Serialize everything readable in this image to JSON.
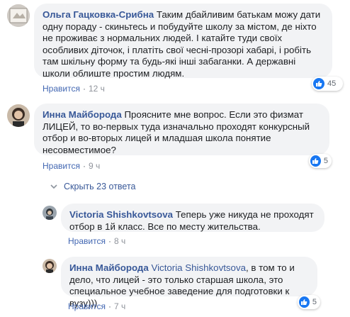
{
  "comments": [
    {
      "author": "Ольга Гацковка-Срибна",
      "text": "Таким дбайливим батькам можу дати одну пораду - скиньтесь и побудуйте школу за містом, де ніхто не проживає з нормальних людей. І катайте туди своїх особливих діточок, і платіть свої чеснi-прозорі хабарі, і робіть там шкільну форму та будь-які інші забаганки. А державні школи облиште простим людям.",
      "like_label": "Нравится",
      "time": "12 ч",
      "reactions": "45"
    },
    {
      "author": "Инна Майборода",
      "text": "Проясните мне вопрос. Если это физмат ЛИЦЕЙ, то во-первых туда изначально проходят конкурсный отбор и во-вторых лицей и младшая школа понятие несовместимое?",
      "like_label": "Нравится",
      "time": "9 ч",
      "reactions": "5"
    }
  ],
  "replies_toggle": "Скрыть 23 ответа",
  "replies": [
    {
      "author": "Victoria Shishkovtsova",
      "text": "Теперь уже никуда не проходят отбор в 1й класс. Все по месту жительства.",
      "like_label": "Нравится",
      "time": "8 ч"
    },
    {
      "author": "Инна Майборода",
      "mention": "Victoria Shishkovtsova",
      "text": ", в том то и дело, что лицей - это только старшая школа, это специальное учебное заведение для подготовки к вузу)))",
      "like_label": "Нравится",
      "time": "7 ч",
      "reactions": "5"
    }
  ],
  "colors": {
    "link": "#385898",
    "like_blue": "#1877f2",
    "bubble": "#f2f3f5"
  },
  "icons": [
    "avatar",
    "like-thumb-icon",
    "chevron-down-icon"
  ]
}
